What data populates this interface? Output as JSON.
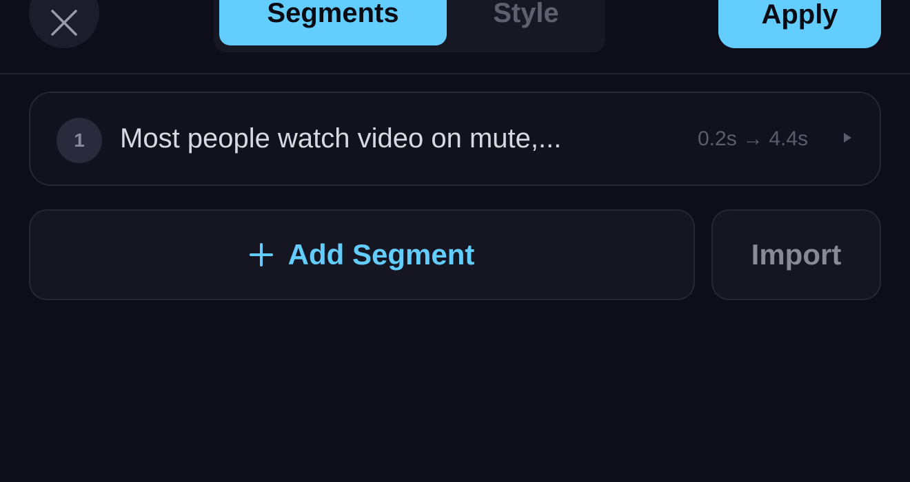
{
  "header": {
    "close_icon": "close-icon",
    "tabs": [
      {
        "label": "Segments",
        "active": true
      },
      {
        "label": "Style",
        "active": false
      }
    ],
    "apply_label": "Apply"
  },
  "segments": [
    {
      "number": "1",
      "text": "Most people watch video on mute,...",
      "time": "0.2s → 4.4s",
      "icon": "play-arrow-icon"
    }
  ],
  "actions": {
    "add_icon": "plus-icon",
    "add_label": "Add Segment",
    "import_label": "Import"
  },
  "colors": {
    "accent": "#63cefe",
    "background": "#0e0e1a"
  }
}
